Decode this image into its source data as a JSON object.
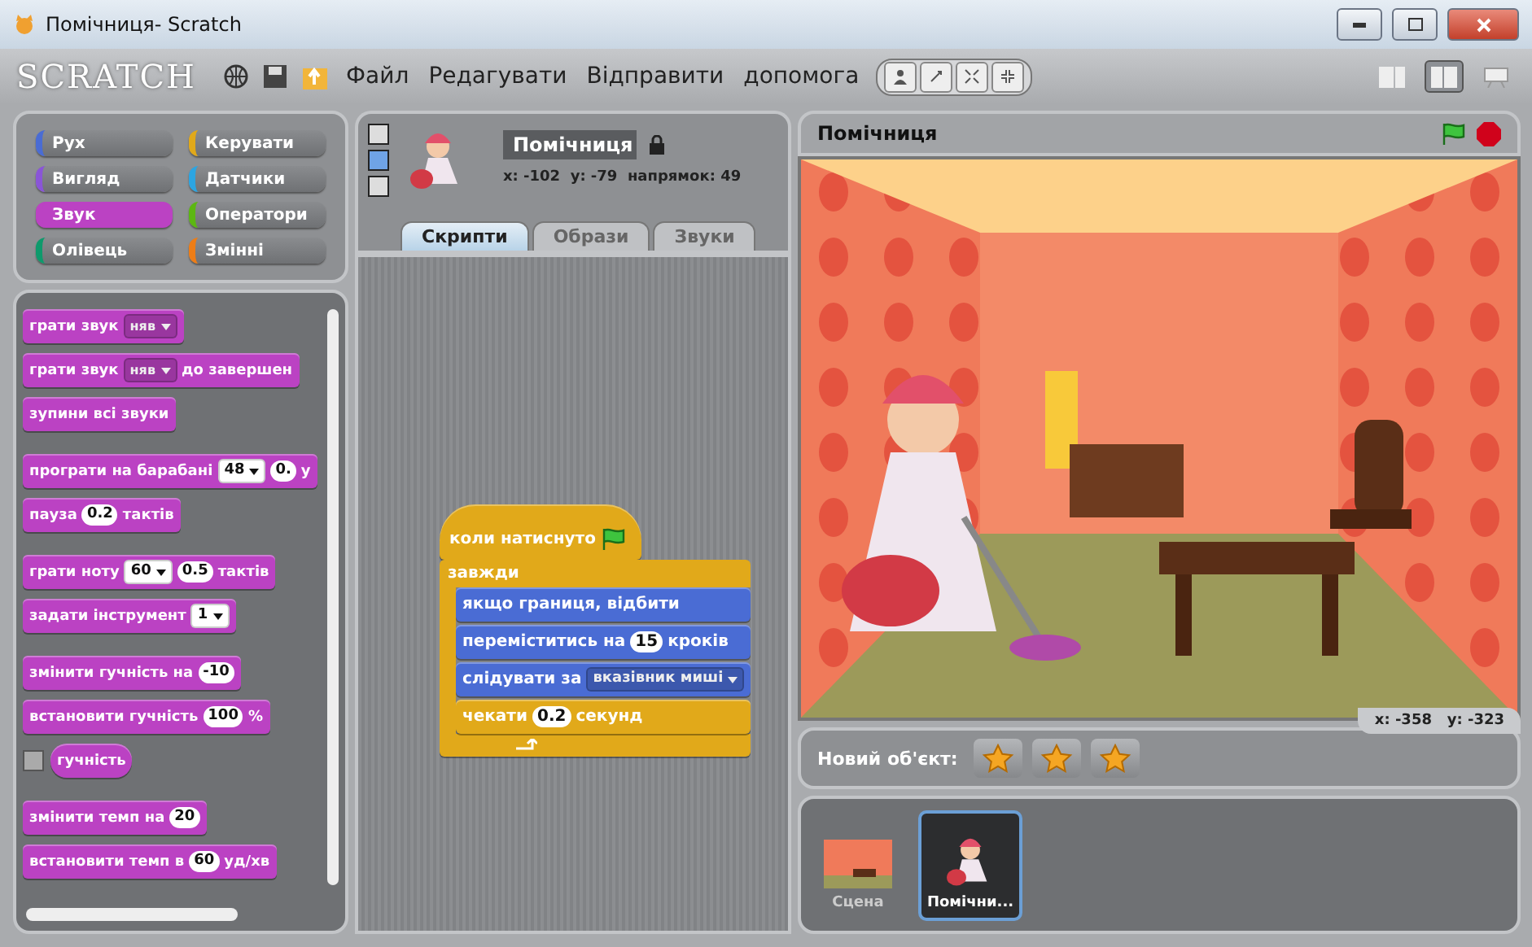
{
  "window": {
    "title": "Помічниця- Scratch"
  },
  "menu": {
    "logo": "SCRATCH",
    "items": [
      "Файл",
      "Редагувати",
      "Відправити",
      "допомога"
    ]
  },
  "view_modes": [
    {
      "selected": false
    },
    {
      "selected": true
    },
    {
      "selected": false
    }
  ],
  "categories": [
    {
      "label": "Рух",
      "color": "#4a6cd4",
      "selected": false
    },
    {
      "label": "Керувати",
      "color": "#e1a91a",
      "selected": false
    },
    {
      "label": "Вигляд",
      "color": "#8a55d7",
      "selected": false
    },
    {
      "label": "Датчики",
      "color": "#2ca5e2",
      "selected": false
    },
    {
      "label": "Звук",
      "color": "#bb42c3",
      "selected": true
    },
    {
      "label": "Оператори",
      "color": "#5cb712",
      "selected": false
    },
    {
      "label": "Олівець",
      "color": "#0e9a6c",
      "selected": false
    },
    {
      "label": "Змінні",
      "color": "#ee7d16",
      "selected": false
    }
  ],
  "palette": {
    "groups": [
      [
        {
          "kind": "command",
          "parts": [
            {
              "kind": "text",
              "text": "грати звук"
            },
            {
              "kind": "menu",
              "text": "няв"
            }
          ]
        },
        {
          "kind": "command",
          "parts": [
            {
              "kind": "text",
              "text": "грати звук"
            },
            {
              "kind": "menu",
              "text": "няв"
            },
            {
              "kind": "text",
              "text": "до завершен"
            }
          ]
        },
        {
          "kind": "command",
          "parts": [
            {
              "kind": "text",
              "text": "зупини всі звуки"
            }
          ]
        }
      ],
      [
        {
          "kind": "command",
          "parts": [
            {
              "kind": "text",
              "text": "програти на барабані"
            },
            {
              "kind": "numbermenu",
              "text": "48"
            },
            {
              "kind": "number",
              "text": "0."
            },
            {
              "kind": "text",
              "text": "у"
            }
          ]
        },
        {
          "kind": "command",
          "parts": [
            {
              "kind": "text",
              "text": "пауза"
            },
            {
              "kind": "number",
              "text": "0.2"
            },
            {
              "kind": "text",
              "text": "тактів"
            }
          ]
        }
      ],
      [
        {
          "kind": "command",
          "parts": [
            {
              "kind": "text",
              "text": "грати ноту"
            },
            {
              "kind": "numbermenu",
              "text": "60"
            },
            {
              "kind": "number",
              "text": "0.5"
            },
            {
              "kind": "text",
              "text": "тактів"
            }
          ]
        },
        {
          "kind": "command",
          "parts": [
            {
              "kind": "text",
              "text": "задати інструмент"
            },
            {
              "kind": "numbermenu",
              "text": "1"
            }
          ]
        }
      ],
      [
        {
          "kind": "command",
          "parts": [
            {
              "kind": "text",
              "text": "змінити гучність на"
            },
            {
              "kind": "number",
              "text": "-10"
            }
          ]
        },
        {
          "kind": "command",
          "parts": [
            {
              "kind": "text",
              "text": "встановити гучність"
            },
            {
              "kind": "number",
              "text": "100"
            },
            {
              "kind": "text",
              "text": "%"
            }
          ]
        },
        {
          "kind": "reporter",
          "checked": false,
          "parts": [
            {
              "kind": "text",
              "text": "гучність"
            }
          ]
        }
      ],
      [
        {
          "kind": "command",
          "parts": [
            {
              "kind": "text",
              "text": "змінити темп на"
            },
            {
              "kind": "number",
              "text": "20"
            }
          ]
        },
        {
          "kind": "command",
          "parts": [
            {
              "kind": "text",
              "text": "встановити темп в"
            },
            {
              "kind": "number",
              "text": "60"
            },
            {
              "kind": "text",
              "text": "уд/хв"
            }
          ]
        }
      ]
    ]
  },
  "sprite": {
    "name": "Помічниця",
    "position": "x: -102  y: -79  напрямок: 49",
    "rotation_styles": [
      {
        "selected": false
      },
      {
        "selected": true
      },
      {
        "selected": false
      }
    ],
    "tabs": [
      {
        "label": "Скрипти",
        "selected": true
      },
      {
        "label": "Образи",
        "selected": false
      },
      {
        "label": "Звуки",
        "selected": false
      }
    ]
  },
  "script": {
    "blocks": [
      {
        "kind": "hat",
        "color": "#e1a91a",
        "parts": [
          {
            "kind": "text",
            "text": "коли натиснуто"
          },
          {
            "kind": "flag"
          }
        ]
      },
      {
        "kind": "c",
        "color": "#e1a91a",
        "parts": [
          {
            "kind": "text",
            "text": "завжди"
          }
        ],
        "children": [
          {
            "kind": "command",
            "color": "#4a6cd4",
            "parts": [
              {
                "kind": "text",
                "text": "якщо границя, відбити"
              }
            ]
          },
          {
            "kind": "command",
            "color": "#4a6cd4",
            "parts": [
              {
                "kind": "text",
                "text": "переміститись на"
              },
              {
                "kind": "number",
                "text": "15"
              },
              {
                "kind": "text",
                "text": "кроків"
              }
            ]
          },
          {
            "kind": "command",
            "color": "#4a6cd4",
            "parts": [
              {
                "kind": "text",
                "text": "слідувати за"
              },
              {
                "kind": "menu",
                "text": "вказівник миші"
              }
            ]
          },
          {
            "kind": "command",
            "color": "#e1a91a",
            "parts": [
              {
                "kind": "text",
                "text": "чекати"
              },
              {
                "kind": "number",
                "text": "0.2"
              },
              {
                "kind": "text",
                "text": "секунд"
              }
            ]
          }
        ]
      }
    ]
  },
  "stage": {
    "title": "Помічниця",
    "mouse": "x: -358   y: -323"
  },
  "new_sprite": {
    "label": "Новий об'єкт:"
  },
  "sprites": [
    {
      "name": "Сцена",
      "kind": "stage",
      "selected": false
    },
    {
      "name": "Помічни...",
      "kind": "sprite",
      "selected": true
    }
  ]
}
